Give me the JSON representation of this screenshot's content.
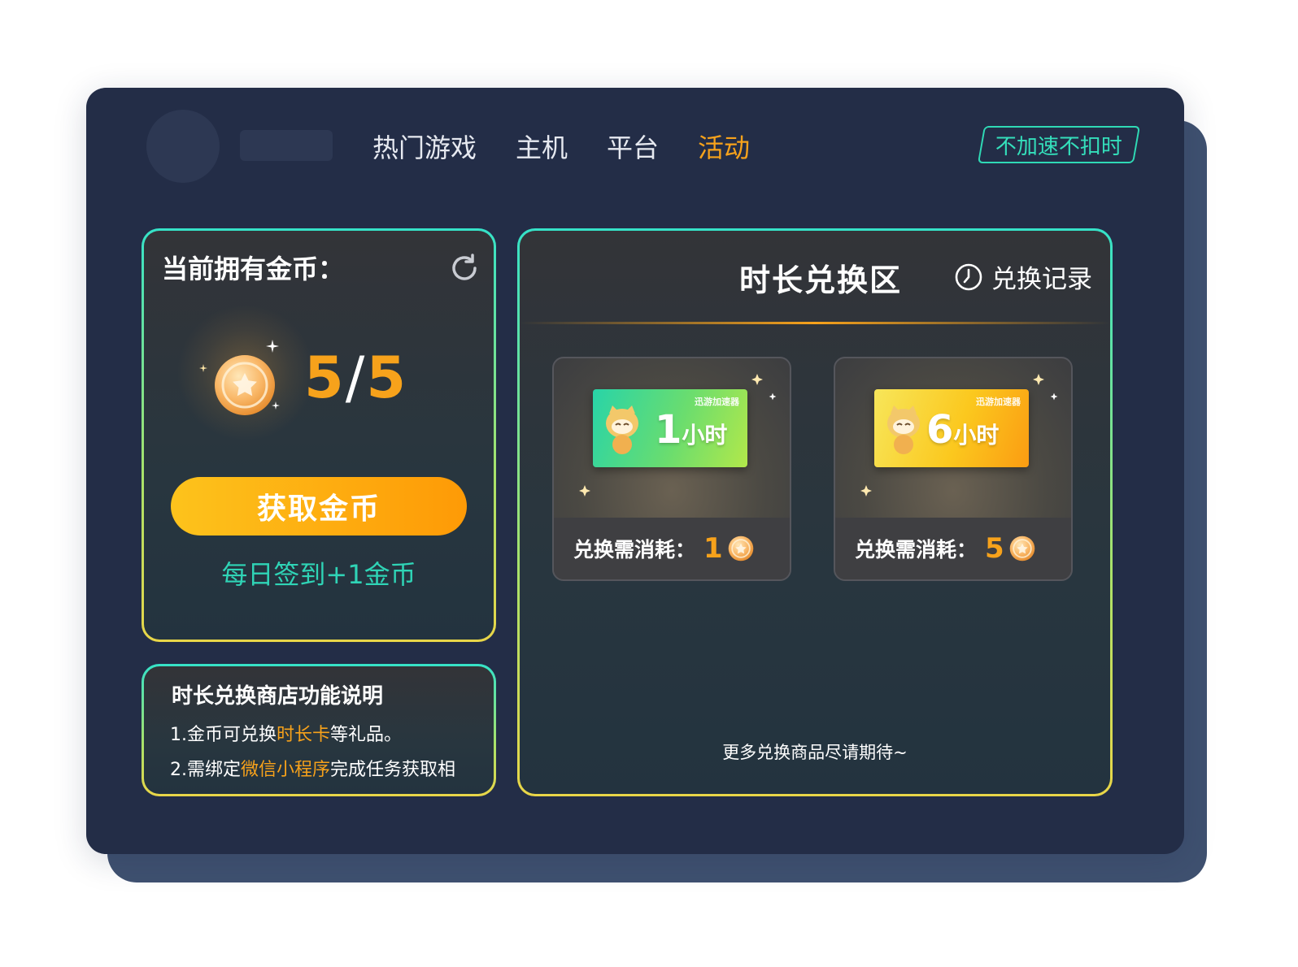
{
  "nav": {
    "items": [
      {
        "label": "热门游戏",
        "active": false
      },
      {
        "label": "主机",
        "active": false
      },
      {
        "label": "平台",
        "active": false
      },
      {
        "label": "活动",
        "active": true
      }
    ],
    "badge": "不加速不扣时"
  },
  "coins": {
    "title": "当前拥有金币：",
    "current": "5",
    "separator": "/",
    "max": "5",
    "get_button": "获取金币",
    "checkin": "每日签到+1金币"
  },
  "info": {
    "title": "时长兑换商店功能说明",
    "line1_a": "1.金币可兑换",
    "line1_hl": "时长卡",
    "line1_b": "等礼品。",
    "line2_a": "2.需绑定",
    "line2_hl": "微信小程序",
    "line2_b": "完成任务获取相"
  },
  "exchange": {
    "title": "时长兑换区",
    "history_label": "兑换记录",
    "cost_label": "兑换需消耗：",
    "items": [
      {
        "brand": "迅游加速器",
        "duration": "1",
        "unit": "小时",
        "cost": "1",
        "theme": "green"
      },
      {
        "brand": "迅游加速器",
        "duration": "6",
        "unit": "小时",
        "cost": "5",
        "theme": "gold"
      }
    ],
    "more": "更多兑换商品尽请期待~"
  },
  "colors": {
    "accent": "#f7a21b",
    "teal": "#2fd4b6",
    "window_bg": "#232d47",
    "back_card": "#3f5170"
  },
  "icons": [
    "refresh-icon",
    "coin-icon",
    "clock-history-icon",
    "sparkle-icon",
    "mascot-icon"
  ]
}
